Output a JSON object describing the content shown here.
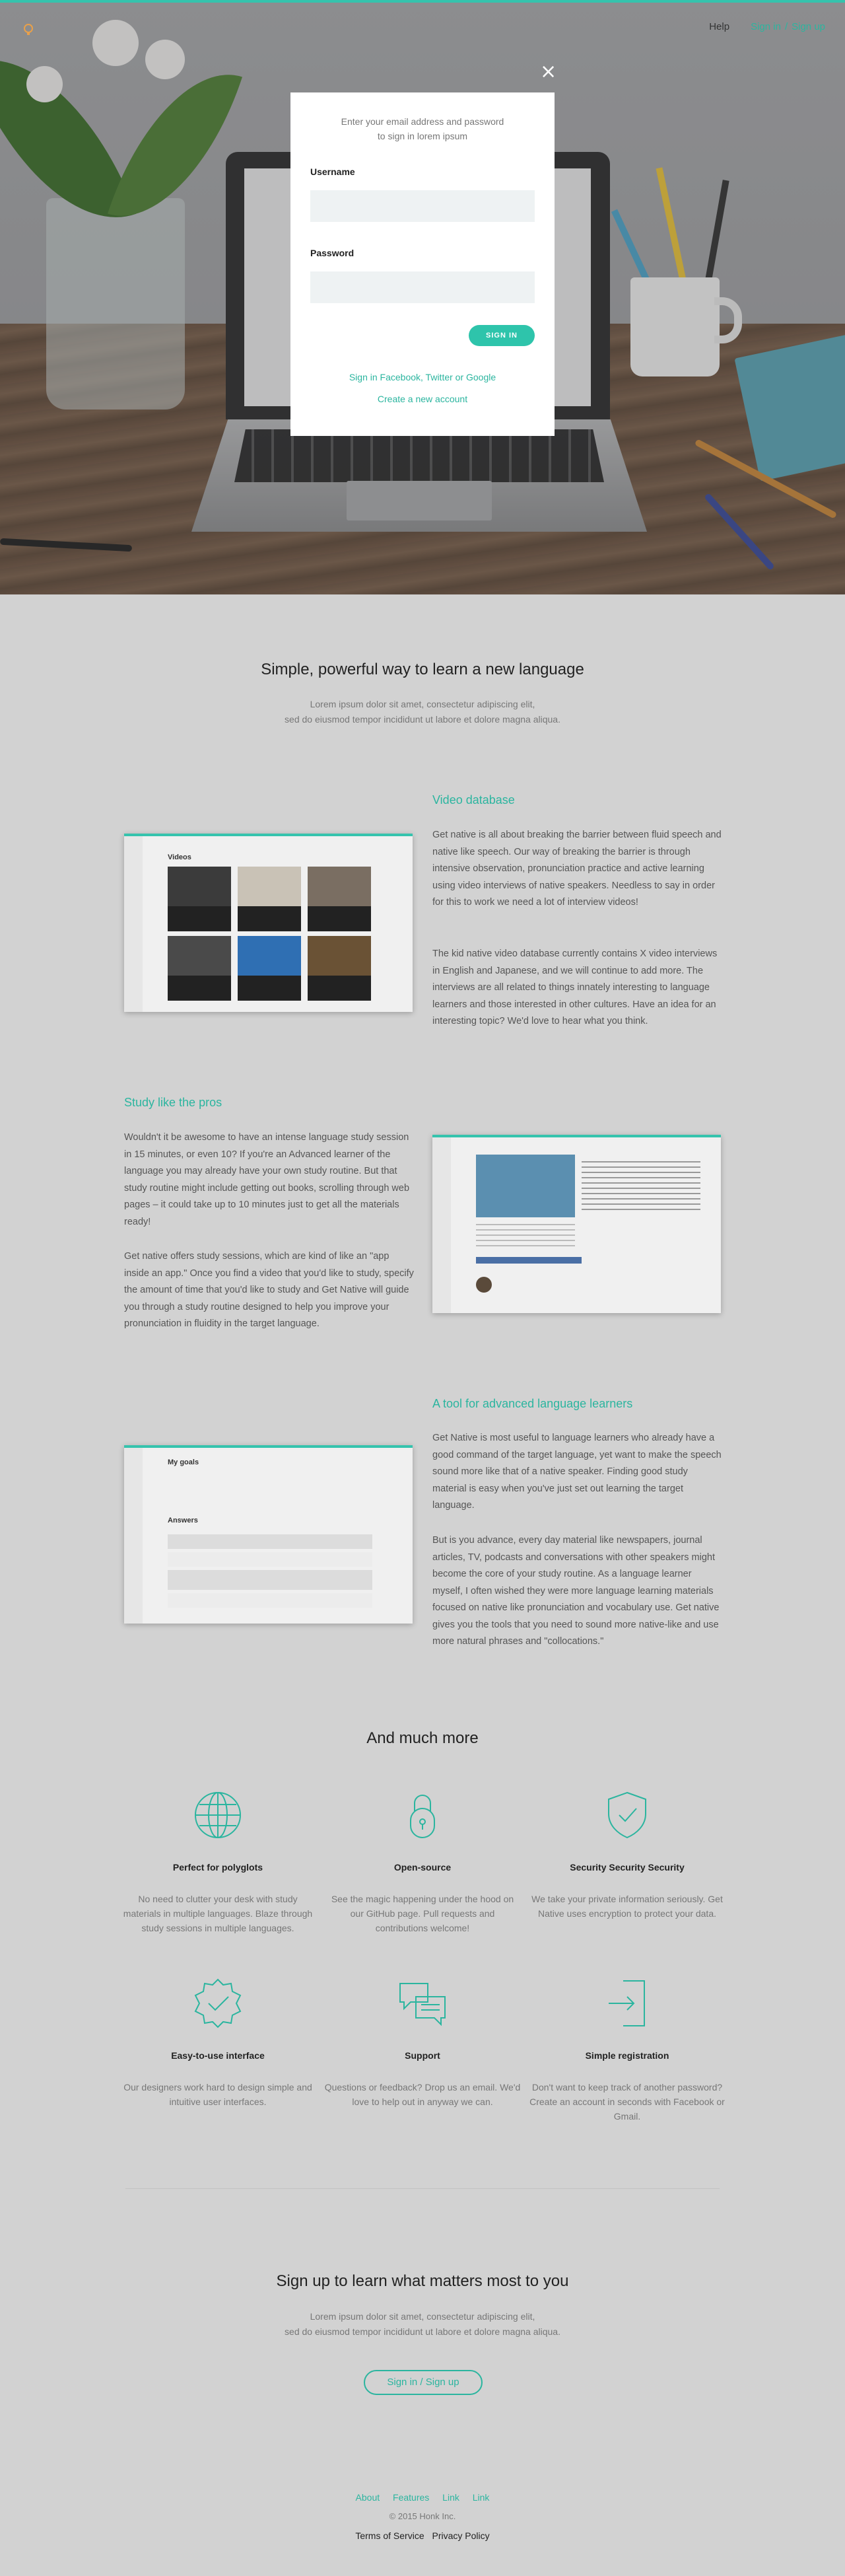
{
  "nav": {
    "help": "Help",
    "sign_in": "Sign in",
    "separator": "/",
    "sign_up": "Sign up"
  },
  "modal": {
    "close": "×",
    "intro": "Enter your email address and password\nto sign in lorem ipsum",
    "username_label": "Username",
    "password_label": "Password",
    "sign_in_button": "SIGN IN",
    "social_link": "Sign in Facebook, Twitter or Google",
    "create_account": "Create a new account"
  },
  "intro": {
    "title": "Simple, powerful way to learn a new language",
    "subtitle": "Lorem ipsum dolor sit amet, consectetur adipiscing elit,\nsed do eiusmod tempor incididunt ut labore et dolore magna aliqua."
  },
  "features": [
    {
      "title": "Video database",
      "paragraphs": [
        "Get native is all about breaking the barrier between fluid speech and native like speech. Our way of breaking the barrier is through intensive observation, pronunciation practice and active learning using video interviews of native speakers. Needless to say in order for this to work we need a lot of interview videos!",
        "The kid native video database currently contains X video interviews in English and Japanese, and we will continue to add more. The interviews are all related to things innately interesting to language learners and those interested in other cultures. Have an idea for an interesting topic? We'd love to hear what you think."
      ]
    },
    {
      "title": "Study like the pros",
      "paragraphs": [
        "Wouldn't it be awesome to have an intense language study session in 15 minutes, or even 10? If you're an Advanced learner of the language you may already have your own study routine. But that study routine might include getting out books, scrolling through web pages – it could take up to 10 minutes just to get all the materials ready!",
        "Get native offers study sessions, which are kind of like an \"app inside an app.\" Once you find a video that you'd like to study, specify the amount of time that you'd like to study and Get Native will guide you through a study routine designed to help you improve your pronunciation in fluidity in the target language."
      ]
    },
    {
      "title": "A tool for advanced language learners",
      "paragraphs": [
        "Get Native is most useful to language learners who already have a good command of the target language, yet want to make the speech sound more like that of a native speaker. Finding good study material is easy when you've just set out learning the target language.",
        "But is you advance, every day material like newspapers, journal articles, TV, podcasts and conversations with other speakers might become the core of your study routine. As a language learner myself, I often wished they were more language learning materials focused on native like pronunciation and vocabulary use. Get native gives you the tools that you need to sound more native-like and use more natural phrases and \"collocations.\""
      ]
    }
  ],
  "shots": {
    "videos_title": "Videos",
    "goals_title": "My goals",
    "answers_title": "Answers"
  },
  "more": {
    "title": "And much more",
    "items": [
      {
        "icon": "globe-icon",
        "title": "Perfect for polyglots",
        "text": "No need to clutter your desk with study materials in multiple languages. Blaze through study sessions in multiple languages."
      },
      {
        "icon": "lock-icon",
        "title": "Open-source",
        "text": "See the magic happening under the hood on our GitHub page. Pull requests and contributions welcome!"
      },
      {
        "icon": "shield-icon",
        "title": "Security Security Security",
        "text": "We take your private information seriously. Get Native uses encryption to protect your data."
      },
      {
        "icon": "badge-check-icon",
        "title": "Easy-to-use interface",
        "text": "Our designers work hard to design simple and intuitive user interfaces."
      },
      {
        "icon": "chat-icon",
        "title": "Support",
        "text": "Questions or feedback? Drop us an email. We'd love to help out in anyway we can."
      },
      {
        "icon": "sign-in-icon",
        "title": "Simple registration",
        "text": "Don't want to keep track of another password? Create an account in seconds with Facebook or Gmail."
      }
    ]
  },
  "cta": {
    "title": "Sign up to learn what matters most to you",
    "subtitle": "Lorem ipsum dolor sit amet, consectetur adipiscing elit,\nsed do eiusmod tempor incididunt ut labore et dolore magna aliqua.",
    "button": "Sign in  /  Sign up"
  },
  "footer": {
    "links": [
      "About",
      "Features",
      "Link",
      "Link"
    ],
    "copyright": "© 2015 Honk Inc.",
    "terms": "Terms of Service",
    "privacy": "Privacy Policy"
  },
  "colors": {
    "accent": "#2bb59f",
    "button": "#2ec4ab",
    "page_bg": "#d2d2d2"
  }
}
